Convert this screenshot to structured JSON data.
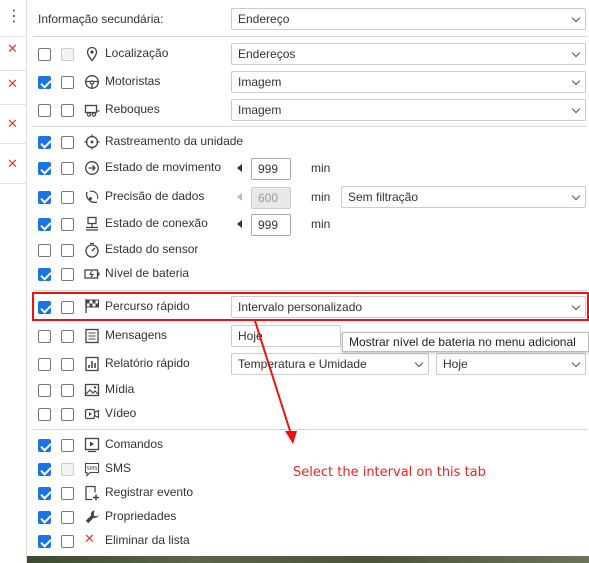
{
  "secondary_info": {
    "label": "Informação secundária:",
    "value": "Endereço"
  },
  "rows": {
    "localizacao": {
      "label": "Localização",
      "select": "Endereços"
    },
    "motoristas": {
      "label": "Motoristas",
      "select": "Imagem"
    },
    "reboques": {
      "label": "Reboques",
      "select": "Imagem"
    },
    "rastreamento": {
      "label": "Rastreamento da unidade"
    },
    "estado_movimento": {
      "label": "Estado de movimento",
      "value": "999",
      "unit": "min"
    },
    "precisao_dados": {
      "label": "Precisão de dados",
      "value": "600",
      "unit": "min",
      "select": "Sem filtração"
    },
    "estado_conexao": {
      "label": "Estado de conexão",
      "value": "999",
      "unit": "min"
    },
    "estado_sensor": {
      "label": "Estado do sensor"
    },
    "nivel_bateria": {
      "label": "Nível de bateria"
    },
    "percurso_rapido": {
      "label": "Percurso rápido",
      "select": "Intervalo personalizado"
    },
    "mensagens": {
      "label": "Mensagens",
      "select": "Hoje"
    },
    "relatorio_rapido": {
      "label": "Relatório rápido",
      "select": "Temperatura e Umidade",
      "select2": "Hoje"
    },
    "midia": {
      "label": "Mídia"
    },
    "video": {
      "label": "Vídeo"
    },
    "comandos": {
      "label": "Comandos"
    },
    "sms": {
      "label": "SMS"
    },
    "registrar_evento": {
      "label": "Registrar evento"
    },
    "propriedades": {
      "label": "Propriedades"
    },
    "eliminar": {
      "label": "Eliminar da lista"
    }
  },
  "tooltip": "Mostrar nível de bateria no menu adicional",
  "annotation": "Select the interval on this tab",
  "colors": {
    "checkbox_on": "#1a73e8",
    "highlight": "#e11111",
    "annotation": "#e22222",
    "delete": "#e53935"
  }
}
